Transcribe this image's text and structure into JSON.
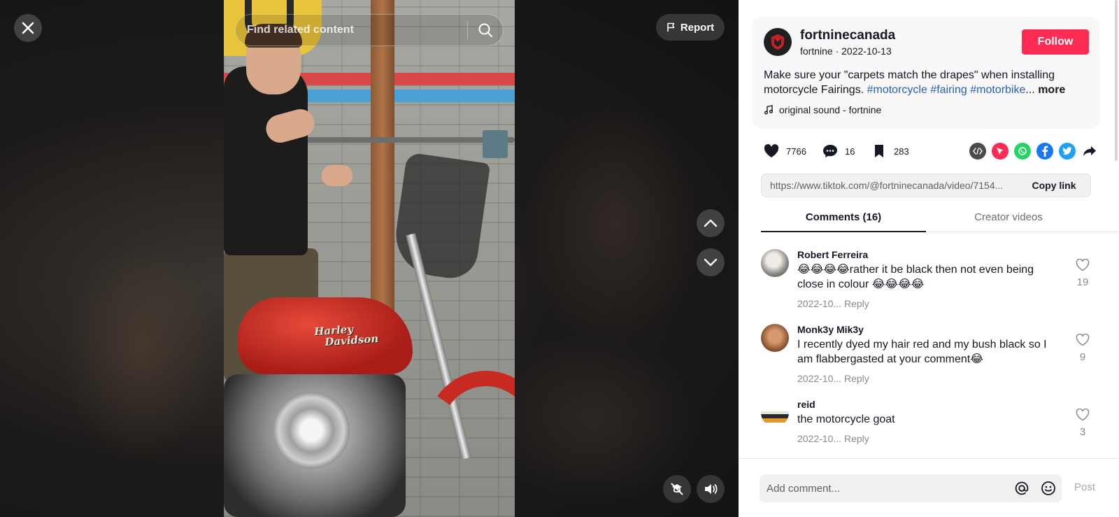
{
  "video": {
    "search": {
      "placeholder": "Find related content"
    },
    "report_label": "Report",
    "tank_logo_line1": "Harley",
    "tank_logo_line2": "Davidson"
  },
  "post": {
    "author": "fortninecanada",
    "meta": "fortnine · 2022-10-13",
    "follow_label": "Follow",
    "description_text": "Make sure your \"carpets match the drapes\" when installing motorcycle Fairings. ",
    "hashtags": [
      "#motorcycle",
      "#fairing",
      "#motorbike"
    ],
    "ellipsis": "...",
    "more_label": "more",
    "sound": "original sound - fortnine"
  },
  "actions": {
    "likes": "7766",
    "comments": "16",
    "saves": "283",
    "share_icons": [
      "embed-icon",
      "send-icon",
      "whatsapp-icon",
      "facebook-icon",
      "twitter-icon",
      "share-arrow-icon"
    ]
  },
  "link": {
    "url": "https://www.tiktok.com/@fortninecanada/video/7154...",
    "copy_label": "Copy link"
  },
  "tabs": {
    "comments": "Comments (16)",
    "creator": "Creator videos"
  },
  "comments": [
    {
      "user": "Robert Ferreira",
      "text": "😂😂😂😂rather it be black then not even being close in colour 😂😂😂😂",
      "date": "2022-10...",
      "reply": "Reply",
      "likes": "19"
    },
    {
      "user": "Monk3y Mik3y",
      "text": "I recently dyed my hair red and my bush black so I am flabbergasted at your comment😂",
      "date": "2022-10...",
      "reply": "Reply",
      "likes": "9"
    },
    {
      "user": "reid",
      "text": "the motorcycle goat",
      "date": "2022-10...",
      "reply": "Reply",
      "likes": "3"
    }
  ],
  "footer": {
    "placeholder": "Add comment...",
    "post_label": "Post"
  },
  "colors": {
    "accent": "#fe2c55",
    "hashtag": "#2b5db9"
  }
}
